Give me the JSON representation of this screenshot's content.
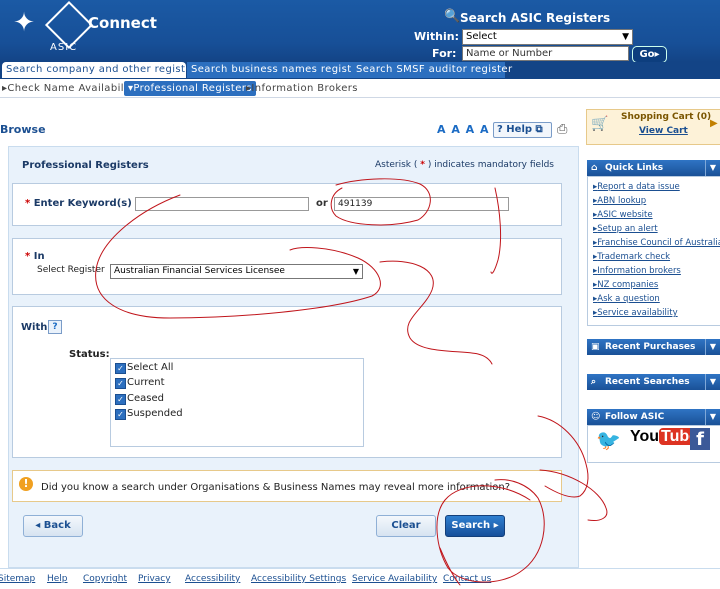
{
  "header": {
    "brand": "Connect",
    "agency": "ASIC",
    "search_title": "Search ASIC Registers",
    "within_label": "Within:",
    "within_value": "Select",
    "for_label": "For:",
    "for_placeholder": "Name or Number",
    "go_label": "Go"
  },
  "tabs": [
    {
      "label": "Search company and other registers"
    },
    {
      "label": "Search business names register"
    },
    {
      "label": "Search SMSF auditor register"
    }
  ],
  "subnav": [
    {
      "label": "Check Name Availability"
    },
    {
      "label": "Professional Registers"
    },
    {
      "label": "Information Brokers"
    }
  ],
  "page": {
    "title": "Browse",
    "font_size_glyphs": "A A A A",
    "help_label": "Help"
  },
  "form": {
    "heading": "Professional Registers",
    "mandatory_note_pre": "Asterisk (",
    "mandatory_star": "*",
    "mandatory_note_post": ") indicates mandatory fields",
    "keyword_label": "Enter Keyword(s)",
    "keyword_value_1": "",
    "or_label": "or",
    "keyword_value_2": "491139",
    "in_label": "In",
    "select_register_label": "Select Register",
    "register_value": "Australian Financial Services Licensee",
    "with_label": "With",
    "status_label": "Status:",
    "statuses": [
      {
        "label": "Select All",
        "checked": true
      },
      {
        "label": "Current",
        "checked": true
      },
      {
        "label": "Ceased",
        "checked": true
      },
      {
        "label": "Suspended",
        "checked": true
      }
    ],
    "tip": "Did you know a search under Organisations & Business Names may reveal more information?",
    "back_label": "Back",
    "clear_label": "Clear",
    "search_label": "Search"
  },
  "sidebar": {
    "cart_title": "Shopping Cart (0)",
    "cart_link": "View Cart",
    "quick_links_title": "Quick Links",
    "quick_links": [
      "Report a data issue",
      "ABN lookup",
      "ASIC website",
      "Setup an alert",
      "Franchise Council of Australia",
      "Trademark check",
      "Information brokers",
      "NZ companies",
      "Ask a question",
      "Service availability"
    ],
    "recent_purchases_title": "Recent Purchases",
    "recent_searches_title": "Recent Searches",
    "follow_title": "Follow ASIC",
    "youtube_you": "You",
    "youtube_tube": "Tube",
    "facebook_letter": "f"
  },
  "footer": [
    "Sitemap",
    "Help",
    "Copyright",
    "Privacy",
    "Accessibility",
    "Accessibility Settings",
    "Service Availability",
    "Contact us"
  ],
  "colors": {
    "brand_blue": "#1b5aa5",
    "accent_blue": "#2c6fbf",
    "required_red": "#cc0000",
    "scribble_red": "#c0151b"
  }
}
